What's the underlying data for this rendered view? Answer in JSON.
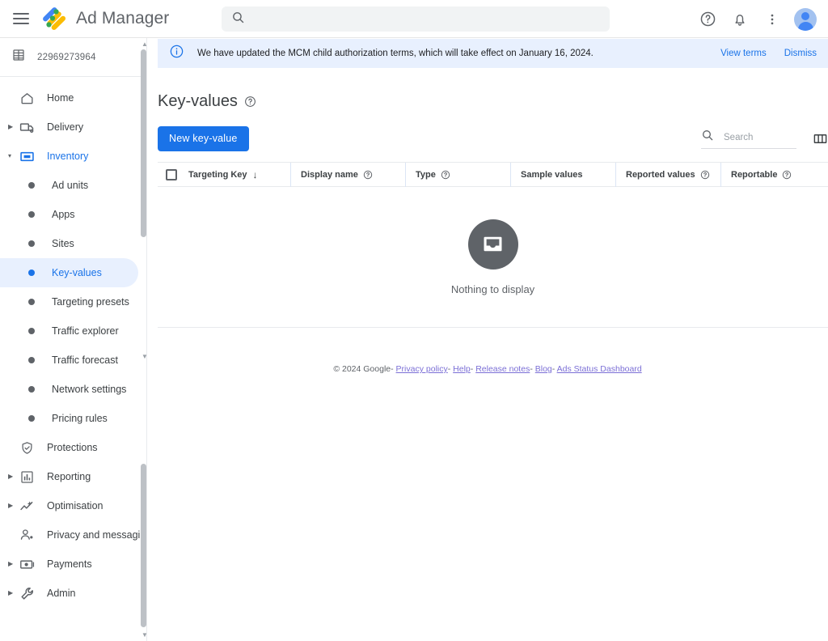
{
  "header": {
    "menu_icon": "hamburger-menu-icon",
    "logo_icon": "ad-manager-logo-icon",
    "brand": "Ad Manager",
    "search": {
      "value": "",
      "placeholder": "",
      "icon": "search-icon"
    },
    "help_icon": "help-icon",
    "notifications_icon": "bell-icon",
    "more_icon": "more-vertical-icon",
    "avatar_icon": "user-avatar-icon"
  },
  "sidebar": {
    "account": {
      "id": "22969273964",
      "icon": "building-icon"
    },
    "items": [
      {
        "label": "Home",
        "icon": "home-icon",
        "level": "top",
        "expandable": false,
        "state": "normal"
      },
      {
        "label": "Delivery",
        "icon": "truck-icon",
        "level": "top",
        "expandable": true,
        "state": "normal"
      },
      {
        "label": "Inventory",
        "icon": "inventory-icon",
        "level": "top",
        "expandable": true,
        "state": "expanded"
      },
      {
        "label": "Ad units",
        "icon": "dot-icon",
        "level": "child",
        "expandable": false,
        "state": "normal"
      },
      {
        "label": "Apps",
        "icon": "dot-icon",
        "level": "child",
        "expandable": false,
        "state": "normal"
      },
      {
        "label": "Sites",
        "icon": "dot-icon",
        "level": "child",
        "expandable": false,
        "state": "normal"
      },
      {
        "label": "Key-values",
        "icon": "dot-icon",
        "level": "child",
        "expandable": false,
        "state": "selected"
      },
      {
        "label": "Targeting presets",
        "icon": "dot-icon",
        "level": "child",
        "expandable": false,
        "state": "normal"
      },
      {
        "label": "Traffic explorer",
        "icon": "dot-icon",
        "level": "child",
        "expandable": false,
        "state": "normal"
      },
      {
        "label": "Traffic forecast",
        "icon": "dot-icon",
        "level": "child",
        "expandable": false,
        "state": "normal"
      },
      {
        "label": "Network settings",
        "icon": "dot-icon",
        "level": "child",
        "expandable": false,
        "state": "normal"
      },
      {
        "label": "Pricing rules",
        "icon": "dot-icon",
        "level": "child",
        "expandable": false,
        "state": "normal"
      },
      {
        "label": "Protections",
        "icon": "shield-icon",
        "level": "top",
        "expandable": false,
        "state": "normal"
      },
      {
        "label": "Reporting",
        "icon": "bar-chart-icon",
        "level": "top",
        "expandable": true,
        "state": "normal"
      },
      {
        "label": "Optimisation",
        "icon": "trending-up-icon",
        "level": "top",
        "expandable": true,
        "state": "normal"
      },
      {
        "label": "Privacy and messaging",
        "icon": "person-icon",
        "level": "top",
        "expandable": false,
        "state": "normal"
      },
      {
        "label": "Payments",
        "icon": "banknote-icon",
        "level": "top",
        "expandable": true,
        "state": "normal"
      },
      {
        "label": "Admin",
        "icon": "wrench-icon",
        "level": "top",
        "expandable": true,
        "state": "normal"
      }
    ]
  },
  "banner": {
    "icon": "info-icon",
    "message": "We have updated the MCM child authorization terms, which will take effect on January 16, 2024.",
    "view_terms_label": "View terms",
    "dismiss_label": "Dismiss"
  },
  "main": {
    "title": "Key-values",
    "title_help_icon": "help-circle-icon",
    "new_button_label": "New key-value",
    "search": {
      "value": "",
      "placeholder": "Search",
      "icon": "search-icon"
    },
    "columns_icon": "columns-icon",
    "table": {
      "select_all_checkbox": "select-all-checkbox",
      "sort_indicator": "↓",
      "headers": [
        {
          "label": "Targeting Key",
          "help": false,
          "sorted": true
        },
        {
          "label": "Display name",
          "help": true,
          "sorted": false
        },
        {
          "label": "Type",
          "help": true,
          "sorted": false
        },
        {
          "label": "Sample values",
          "help": false,
          "sorted": false
        },
        {
          "label": "Reported values",
          "help": true,
          "sorted": false
        },
        {
          "label": "Reportable",
          "help": true,
          "sorted": false
        }
      ],
      "rows": [],
      "empty_state": {
        "icon": "inbox-icon",
        "text": "Nothing to display"
      }
    }
  },
  "footer": {
    "copyright": "© 2024 Google",
    "links": [
      "Privacy policy",
      "Help",
      "Release notes",
      "Blog",
      "Ads Status Dashboard"
    ],
    "separator": "-"
  },
  "colors": {
    "accent": "#1a73e8",
    "banner_bg": "#e8f0fe",
    "text": "#3c4043",
    "muted": "#5f6368",
    "footer_link": "#7b6fd6"
  }
}
